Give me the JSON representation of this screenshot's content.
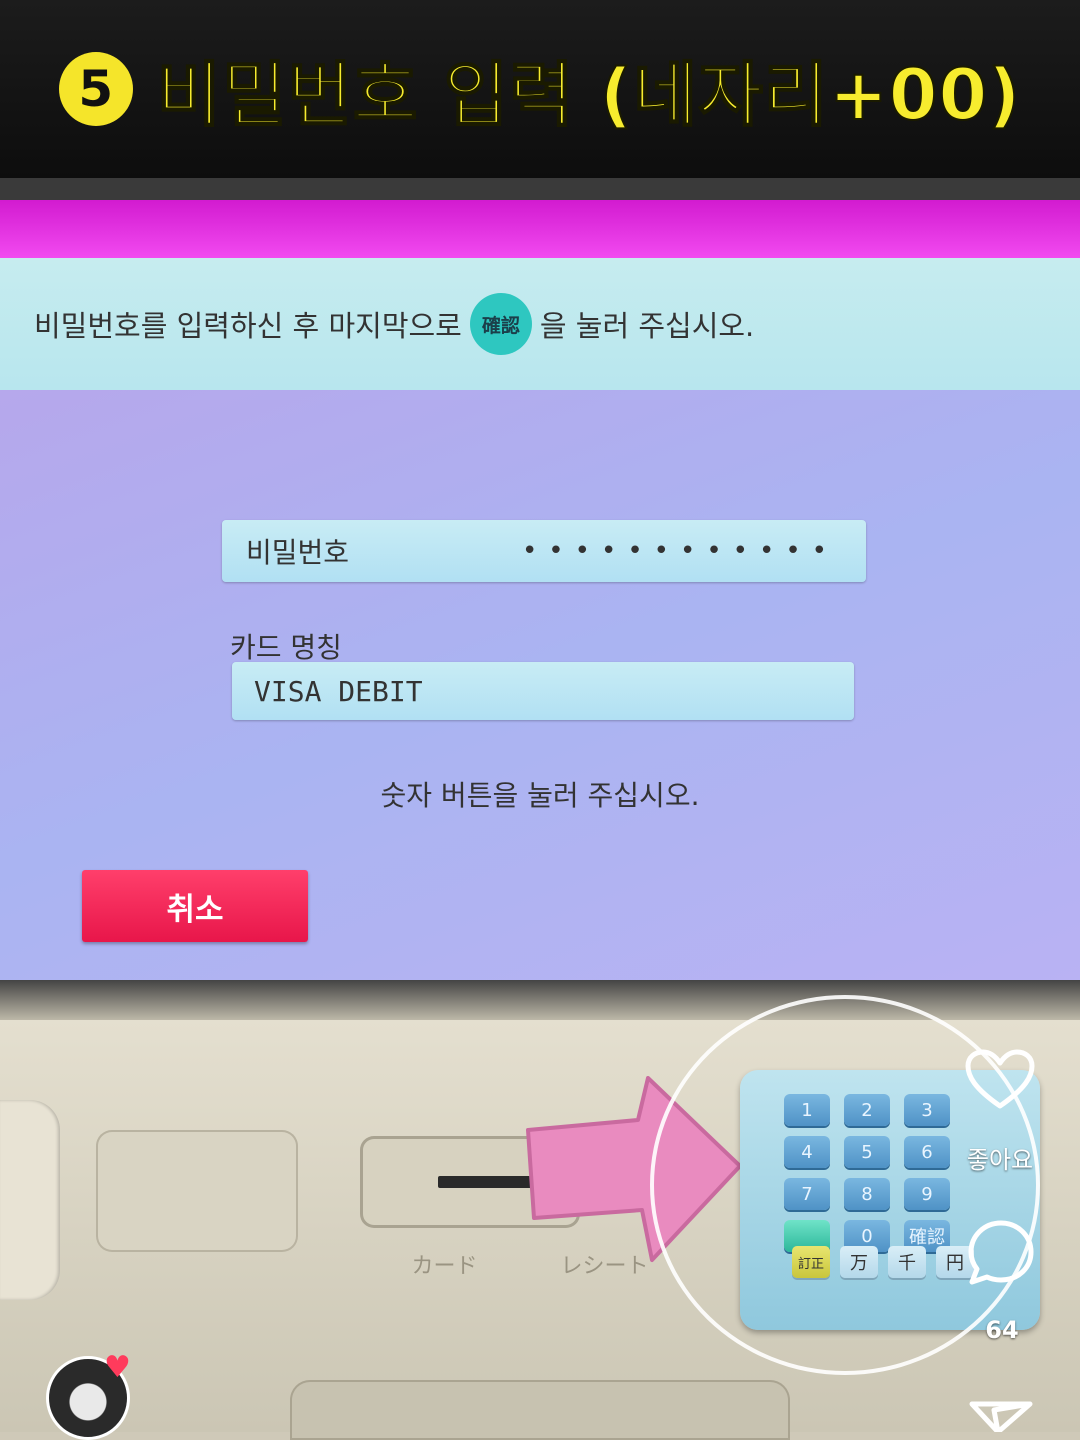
{
  "caption": {
    "step": "5",
    "title": "비밀번호 입력 (네자리+00)"
  },
  "screen": {
    "instruction_before": "비밀번호를 입력하신 후 마지막으로",
    "confirm_chip": "確認",
    "instruction_after": "을 눌러 주십시오.",
    "password_label": "비밀번호",
    "password_mask": "••••••••••••",
    "card_name_label": "카드 명칭",
    "card_name_value": "VISA DEBIT",
    "prompt": "숫자 버튼을 눌러 주십시오.",
    "cancel_label": "취소"
  },
  "machine": {
    "slot_labels": [
      "カード",
      "レシート"
    ],
    "keypad": {
      "keys": [
        "1",
        "2",
        "3",
        "4",
        "5",
        "6",
        "7",
        "8",
        "9",
        "",
        "0",
        "確認"
      ],
      "function_keys": [
        "訂正",
        "万",
        "千",
        "円"
      ]
    }
  },
  "social": {
    "like_label": "좋아요",
    "comment_count": "64",
    "icons": [
      "heart-icon",
      "comment-icon",
      "share-icon"
    ]
  },
  "colors": {
    "magenta": "#f24af0",
    "cancel": "#ff3f6b",
    "caption_yellow": "#f7ec2e",
    "confirm_teal": "#2ec7c0"
  }
}
